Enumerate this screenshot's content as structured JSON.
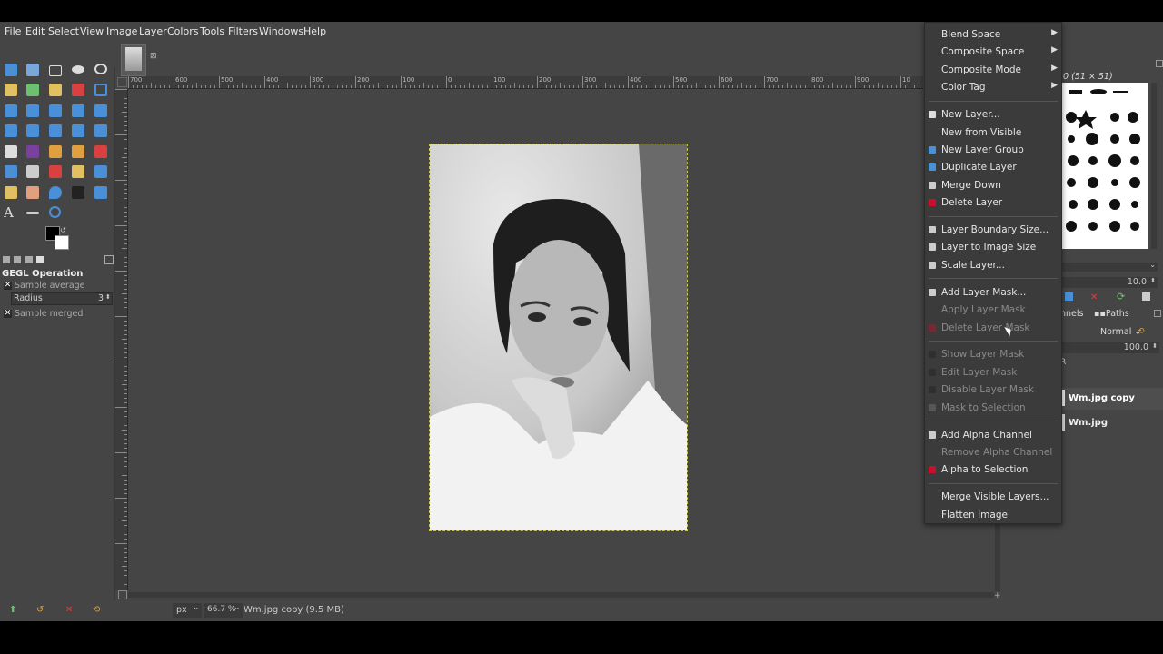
{
  "menubar": [
    "File",
    "Edit",
    "Select",
    "View",
    "Image",
    "Layer",
    "Colors",
    "Tools",
    "Filters",
    "Windows",
    "Help"
  ],
  "image_tab": {
    "close": "⊠"
  },
  "ruler_top_labels": [
    "700",
    "600",
    "500",
    "400",
    "300",
    "200",
    "100",
    "0",
    "100",
    "200",
    "300",
    "400",
    "500",
    "600",
    "700",
    "800",
    "900",
    "10",
    "11",
    "12"
  ],
  "tool_options": {
    "title": "GEGL Operation",
    "sample_average": "Sample average",
    "radius_label": "Radius",
    "radius_value": "3",
    "sample_merged": "Sample merged"
  },
  "layer_menu": {
    "items": [
      {
        "label": "Blend Space",
        "submenu": true,
        "icon": ""
      },
      {
        "label": "Composite Space",
        "submenu": true,
        "icon": ""
      },
      {
        "label": "Composite Mode",
        "submenu": true,
        "icon": ""
      },
      {
        "label": "Color Tag",
        "submenu": true,
        "icon": ""
      },
      {
        "label": "New Layer...",
        "icon": "new-layer-icon"
      },
      {
        "label": "New from Visible",
        "icon": ""
      },
      {
        "label": "New Layer Group",
        "icon": "layer-group-icon"
      },
      {
        "label": "Duplicate Layer",
        "icon": "duplicate-icon"
      },
      {
        "label": "Merge Down",
        "icon": "merge-down-icon"
      },
      {
        "label": "Delete Layer",
        "icon": "delete-icon"
      },
      {
        "label": "Layer Boundary Size...",
        "icon": "boundary-icon"
      },
      {
        "label": "Layer to Image Size",
        "icon": "image-size-icon"
      },
      {
        "label": "Scale Layer...",
        "icon": "scale-icon"
      },
      {
        "label": "Add Layer Mask...",
        "icon": "mask-icon"
      },
      {
        "label": "Apply Layer Mask",
        "icon": "",
        "disabled": true
      },
      {
        "label": "Delete Layer Mask",
        "icon": "delete-icon",
        "disabled": true
      },
      {
        "label": "Show Layer Mask",
        "icon": "checkbox-icon",
        "disabled": true
      },
      {
        "label": "Edit Layer Mask",
        "icon": "checkbox-icon",
        "disabled": true
      },
      {
        "label": "Disable Layer Mask",
        "icon": "checkbox-icon",
        "disabled": true
      },
      {
        "label": "Mask to Selection",
        "icon": "mask-selection-icon",
        "disabled": true
      },
      {
        "label": "Add Alpha Channel",
        "icon": "alpha-icon"
      },
      {
        "label": "Remove Alpha Channel",
        "icon": "",
        "disabled": true
      },
      {
        "label": "Alpha to Selection",
        "icon": "alpha-selection-icon"
      },
      {
        "label": "Merge Visible Layers...",
        "icon": ""
      },
      {
        "label": "Flatten Image",
        "icon": ""
      }
    ]
  },
  "dock": {
    "brush_title": "0 (51 × 51)",
    "spacing_value": "10.0",
    "tabs_label": "nnels",
    "paths_tab": "Paths",
    "mode": "Normal",
    "opacity": "100.0",
    "layers": [
      "Wm.jpg copy",
      "Wm.jpg"
    ]
  },
  "status": {
    "unit": "px",
    "zoom": "66.7 %",
    "image_info": "Wm.jpg copy (9.5 MB)"
  },
  "colors": {
    "accent_red": "#c8102e",
    "canvas_bg": "#454545"
  }
}
